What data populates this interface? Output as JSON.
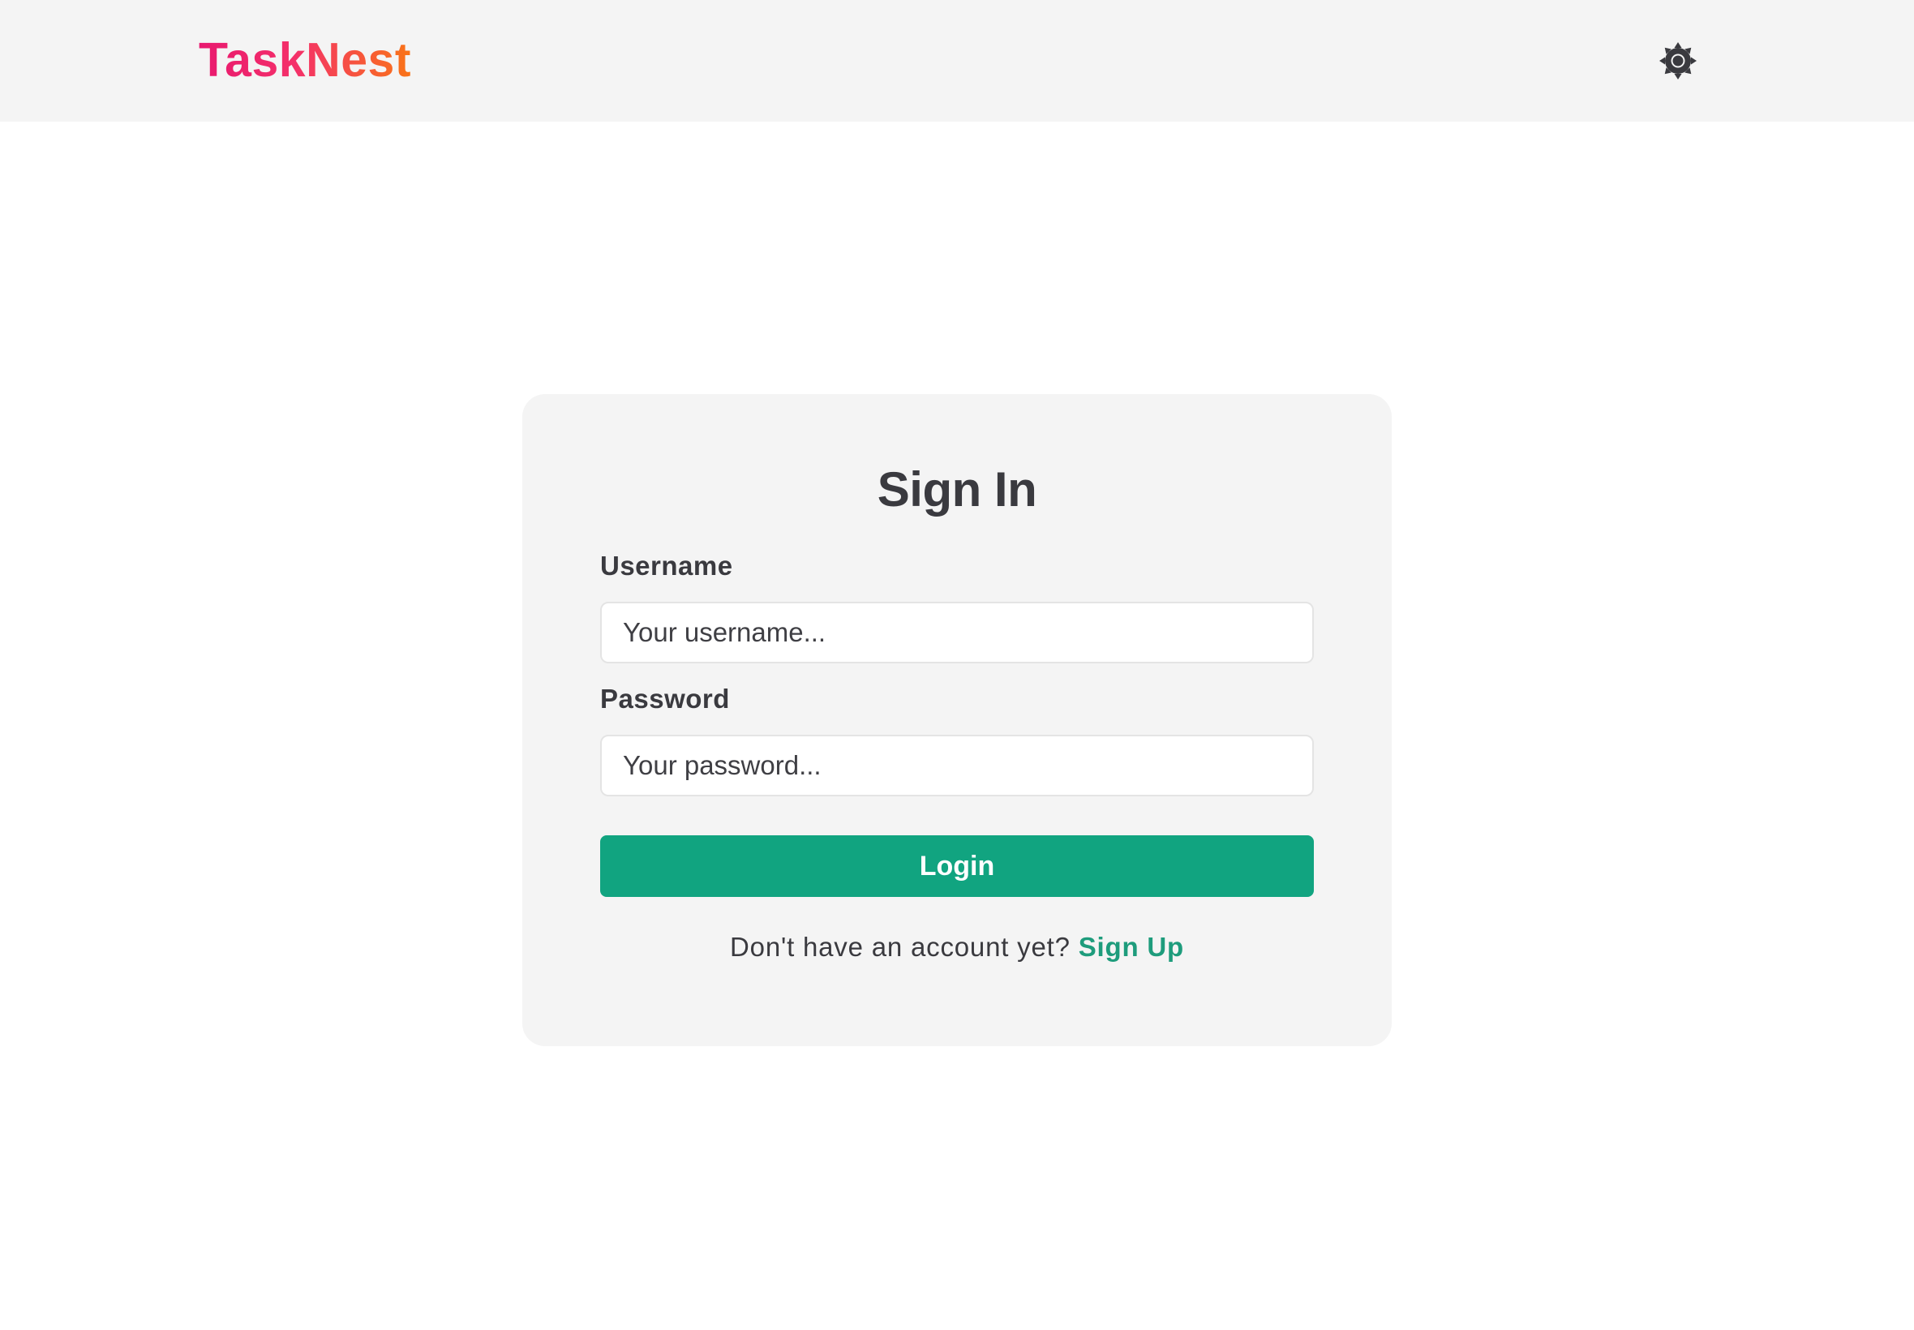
{
  "header": {
    "brand": "TaskNest",
    "theme_toggle_icon": "sun-icon",
    "brand_gradient": [
      "#e8186f",
      "#f97417"
    ],
    "background": "#f4f4f4"
  },
  "signin": {
    "title": "Sign In",
    "username_label": "Username",
    "username_placeholder": "Your username...",
    "username_value": "",
    "password_label": "Password",
    "password_placeholder": "Your password...",
    "password_value": "",
    "login_label": "Login",
    "signup_prompt": "Don't have an account yet?",
    "signup_link": "Sign Up",
    "accent_color": "#11a480"
  }
}
